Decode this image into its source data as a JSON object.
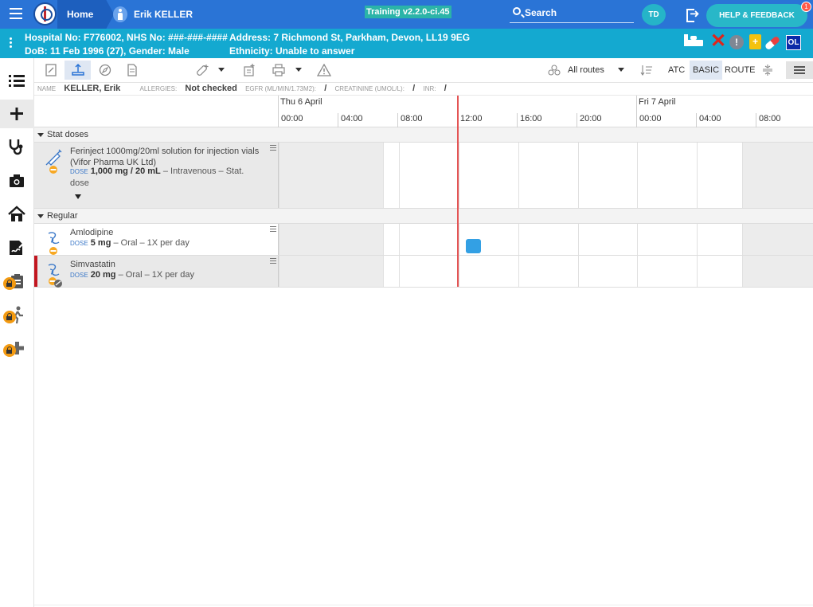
{
  "topbar": {
    "home_label": "Home",
    "patient_name": "Erik KELLER",
    "version": "Training v2.2.0-ci.45",
    "search_label": "Search",
    "user_initials": "TD",
    "help_label": "HELP & FEEDBACK",
    "help_badge": "1"
  },
  "banner": {
    "line1_left": "Hospital No: F776002, NHS No: ###-###-####",
    "line2_left": "DoB: 11 Feb 1996 (27), Gender: Male",
    "line1_mid": "Address: 7 Richmond St, Parkham, Devon, LL19 9EG",
    "line2_mid": "Ethnicity: Unable to answer",
    "ol_badge": "OL",
    "bottle_glyph": "+",
    "alert_glyph": "!"
  },
  "rail": {
    "items": [
      "list-icon",
      "plus-icon",
      "stethoscope-icon",
      "camera-icon",
      "home-icon",
      "signature-icon",
      "clipboard-icon",
      "walking-icon",
      "medical-cross-icon"
    ]
  },
  "toolbar": {
    "routes_label": "All routes",
    "atc_label": "ATC",
    "basic_label": "BASIC",
    "route_label": "ROUTE"
  },
  "info": {
    "name_label": "NAME",
    "name_value": "KELLER, Erik",
    "allergies_label": "ALLERGIES:",
    "allergies_value": "Not checked",
    "egfr_label": "EGFR (ML/MIN/1.73M2):",
    "egfr_value": "/",
    "creatinine_label": "CREATININE (UMOL/L):",
    "creatinine_value": "/",
    "inr_label": "INR:",
    "inr_value": "/"
  },
  "timeline": {
    "days": [
      "Thu 6 April",
      "Fri 7 April"
    ],
    "ticks": [
      "00:00",
      "04:00",
      "08:00",
      "12:00",
      "16:00",
      "20:00",
      "00:00",
      "04:00",
      "08:00"
    ]
  },
  "groups": {
    "stat": "Stat doses",
    "regular": "Regular"
  },
  "meds": {
    "ferinject": {
      "name": "Ferinject 1000mg/20ml solution for injection vials (Vifor Pharma UK Ltd)",
      "dose_label": "DOSE",
      "dose_value": "1,000 mg / 20 mL",
      "dose_rest": " – Intravenous – Stat. dose"
    },
    "amlodipine": {
      "name": "Amlodipine",
      "dose_label": "DOSE",
      "dose_value": "5 mg",
      "dose_rest": " – Oral – 1X per day"
    },
    "simvastatin": {
      "name": "Simvastatin",
      "dose_label": "DOSE",
      "dose_value": "20 mg",
      "dose_rest": " – Oral – 1X per day"
    }
  },
  "colors": {
    "topbar": "#2a74d6",
    "banner": "#14a9d0",
    "now_line": "#e45454",
    "dose_block": "#33a0e4",
    "flag": "#c2161f"
  }
}
